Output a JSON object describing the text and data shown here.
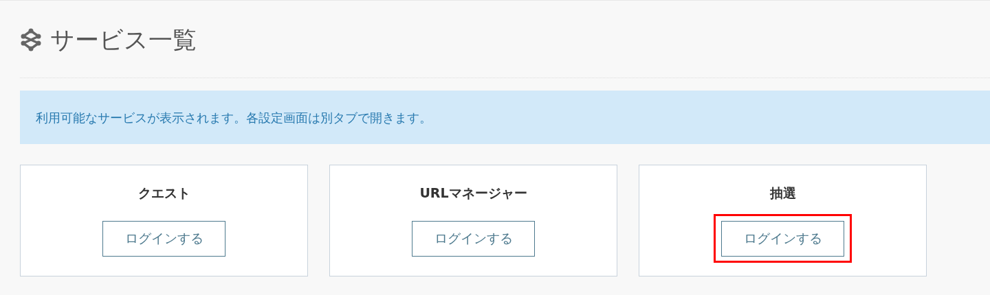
{
  "page_title": "サービス一覧",
  "info": "利用可能なサービスが表示されます。各設定画面は別タブで開きます。",
  "services": [
    {
      "name": "クエスト",
      "button": "ログインする",
      "highlighted": false
    },
    {
      "name": "URLマネージャー",
      "button": "ログインする",
      "highlighted": false
    },
    {
      "name": "抽選",
      "button": "ログインする",
      "highlighted": true
    }
  ]
}
